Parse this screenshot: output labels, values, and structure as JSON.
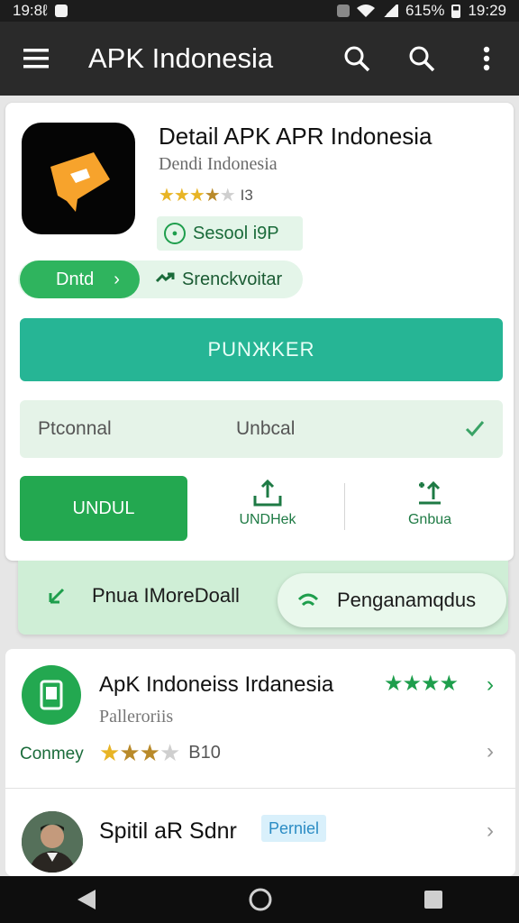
{
  "status_bar": {
    "time_left": "19:8ℓ",
    "battery_pct": "615%",
    "time_right": "19:29"
  },
  "app_bar": {
    "title": "APK Indonesia"
  },
  "detail": {
    "title": "Detail APK APR Indonesia",
    "developer": "Dendi Indonesia",
    "rating_stars": 3,
    "rating_count": "I3",
    "age_chip": "Sesool i9P",
    "pill_primary": "Dntd",
    "pill_secondary": "Srenckvoitar",
    "main_button": "PUNЖKER",
    "select": {
      "label_a": "Ptconnal",
      "label_b": "Unbcal"
    },
    "action_button": "UNDUL",
    "action_1": "UNDHek",
    "action_2": "Gnbua"
  },
  "banner": {
    "left_text": "Pnua IMoreDoall",
    "pill_text": "Penganamqdus"
  },
  "list": [
    {
      "title": "ApK Indoneiss Irdanesia",
      "stars": 4,
      "subtitle": "Palleroriis",
      "company": "Conmey",
      "rating_stars": 3,
      "rating_count": "B10"
    },
    {
      "title": "Spitil aR Sdnr",
      "badge": "Perniel"
    }
  ],
  "colors": {
    "accent_green": "#23a850",
    "teal_button": "#26b595",
    "app_bar": "#2a2a2a"
  }
}
